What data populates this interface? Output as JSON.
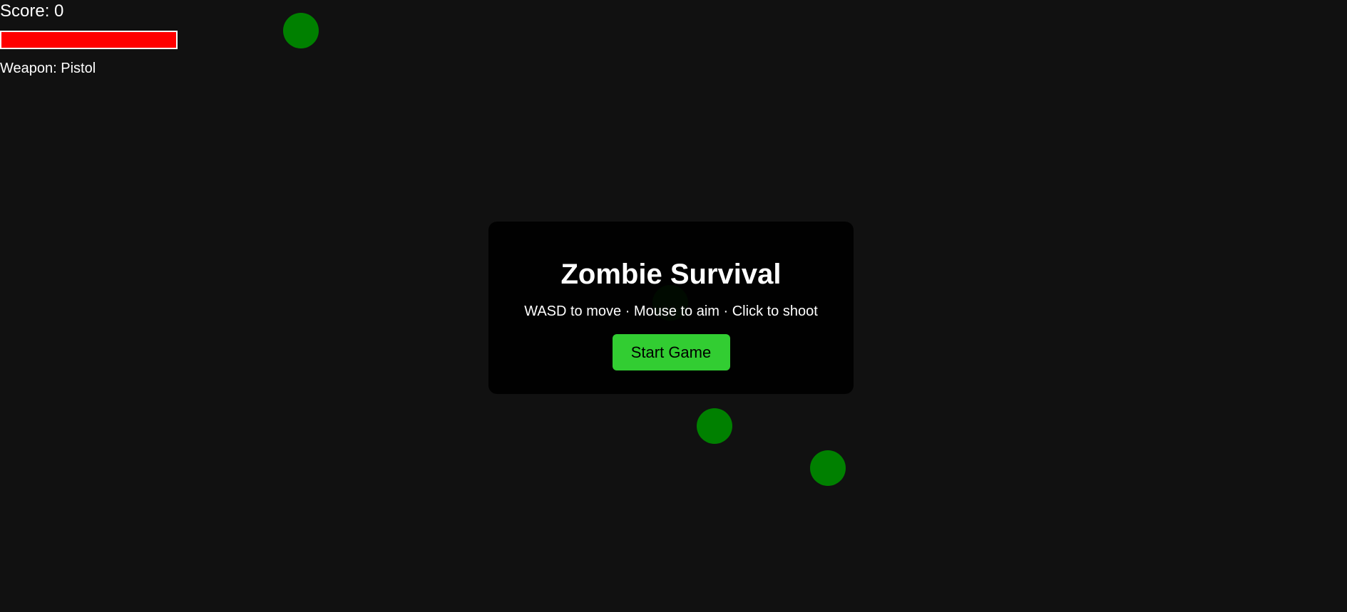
{
  "hud": {
    "score_label": "Score: 0",
    "health_fraction": 1.0,
    "weapon_label": "Weapon: Pistol"
  },
  "menu": {
    "title": "Zombie Survival",
    "instructions": "WASD to move · Mouse to aim · Click to shoot",
    "start_label": "Start Game"
  },
  "colors": {
    "background": "#111111",
    "health_fill": "#ff0000",
    "zombie": "#008000",
    "start_button": "#32cd32"
  }
}
